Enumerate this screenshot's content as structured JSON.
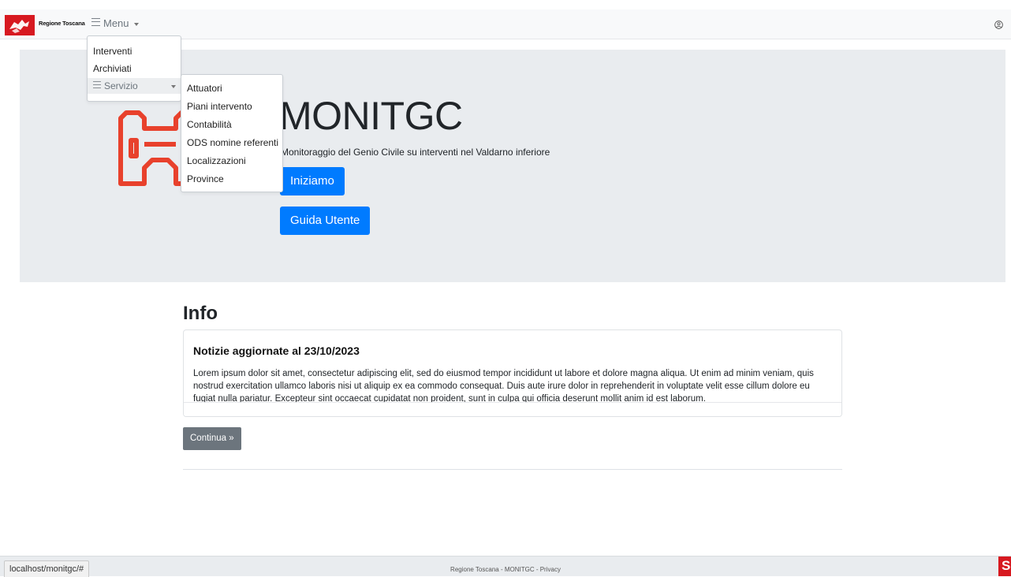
{
  "navbar": {
    "brand_name": "Regione Toscana",
    "menu_label": "Menu"
  },
  "menu": {
    "items": [
      "Interventi",
      "Archiviati"
    ],
    "servizio_label": "Servizio",
    "servizio_items": [
      "Attuatori",
      "Piani intervento",
      "Contabilità",
      "ODS nomine referenti",
      "Localizzazioni",
      "Province"
    ]
  },
  "jumbotron": {
    "title": "MONITGC",
    "subtitle": "Monitoraggio del Genio Civile su interventi nel Valdarno inferiore",
    "start_button": "Iniziamo",
    "guide_button": "Guida Utente"
  },
  "info": {
    "heading": "Info",
    "card_title": "Notizie aggiornate al 23/10/2023",
    "card_text": "Lorem ipsum dolor sit amet, consectetur adipiscing elit, sed do eiusmod tempor incididunt ut labore et dolore magna aliqua. Ut enim ad minim veniam, quis nostrud exercitation ullamco laboris nisi ut aliquip ex ea commodo consequat. Duis aute irure dolor in reprehenderit in voluptate velit esse cillum dolore eu fugiat nulla pariatur. Excepteur sint occaecat cupidatat non proident, sunt in culpa qui officia deserunt mollit anim id est laborum.",
    "continue_button": "Continua »"
  },
  "footer": {
    "text": "Regione Toscana - MONITGC - Privacy"
  },
  "statusbar": {
    "url": "localhost/monitgc/#"
  },
  "colors": {
    "brand_red": "#d71920",
    "primary": "#007bff",
    "secondary": "#6c757d"
  }
}
